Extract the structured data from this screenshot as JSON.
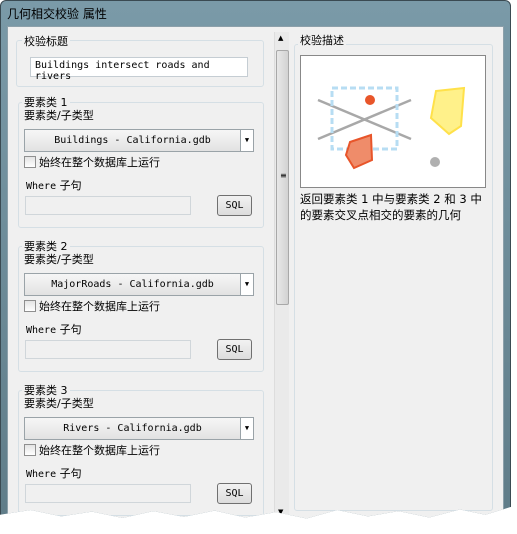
{
  "window": {
    "title": "几何相交校验 属性"
  },
  "check_title": {
    "label": "校验标题",
    "value": "Buildings intersect roads and rivers"
  },
  "feature_classes": [
    {
      "label": "要素类 1",
      "subtype_label": "要素类/子类型",
      "selected": "Buildings -  California.gdb",
      "checkbox_label": "始终在整个数据库上运行",
      "checked": false,
      "where_label": "Where",
      "where_label_cn": "子句",
      "where_value": "",
      "sql_label": "SQL"
    },
    {
      "label": "要素类 2",
      "subtype_label": "要素类/子类型",
      "selected": "MajorRoads -  California.gdb",
      "checkbox_label": "始终在整个数据库上运行",
      "checked": false,
      "where_label": "Where",
      "where_label_cn": "子句",
      "where_value": "",
      "sql_label": "SQL"
    },
    {
      "label": "要素类 3",
      "subtype_label": "要素类/子类型",
      "selected": "Rivers -  California.gdb",
      "checkbox_label": "始终在整个数据库上运行",
      "checked": false,
      "where_label": "Where",
      "where_label_cn": "子句",
      "where_value": "",
      "sql_label": "SQL"
    }
  ],
  "description": {
    "label": "校验描述",
    "text": "返回要素类 1 中与要素类 2 和 3 中的要素交叉点相交的要素的几何"
  },
  "colors": {
    "orange": "#e8552a",
    "yellow": "#fff18a",
    "dashed_box": "#b7ddf3",
    "lines": "#a8a8a8"
  }
}
